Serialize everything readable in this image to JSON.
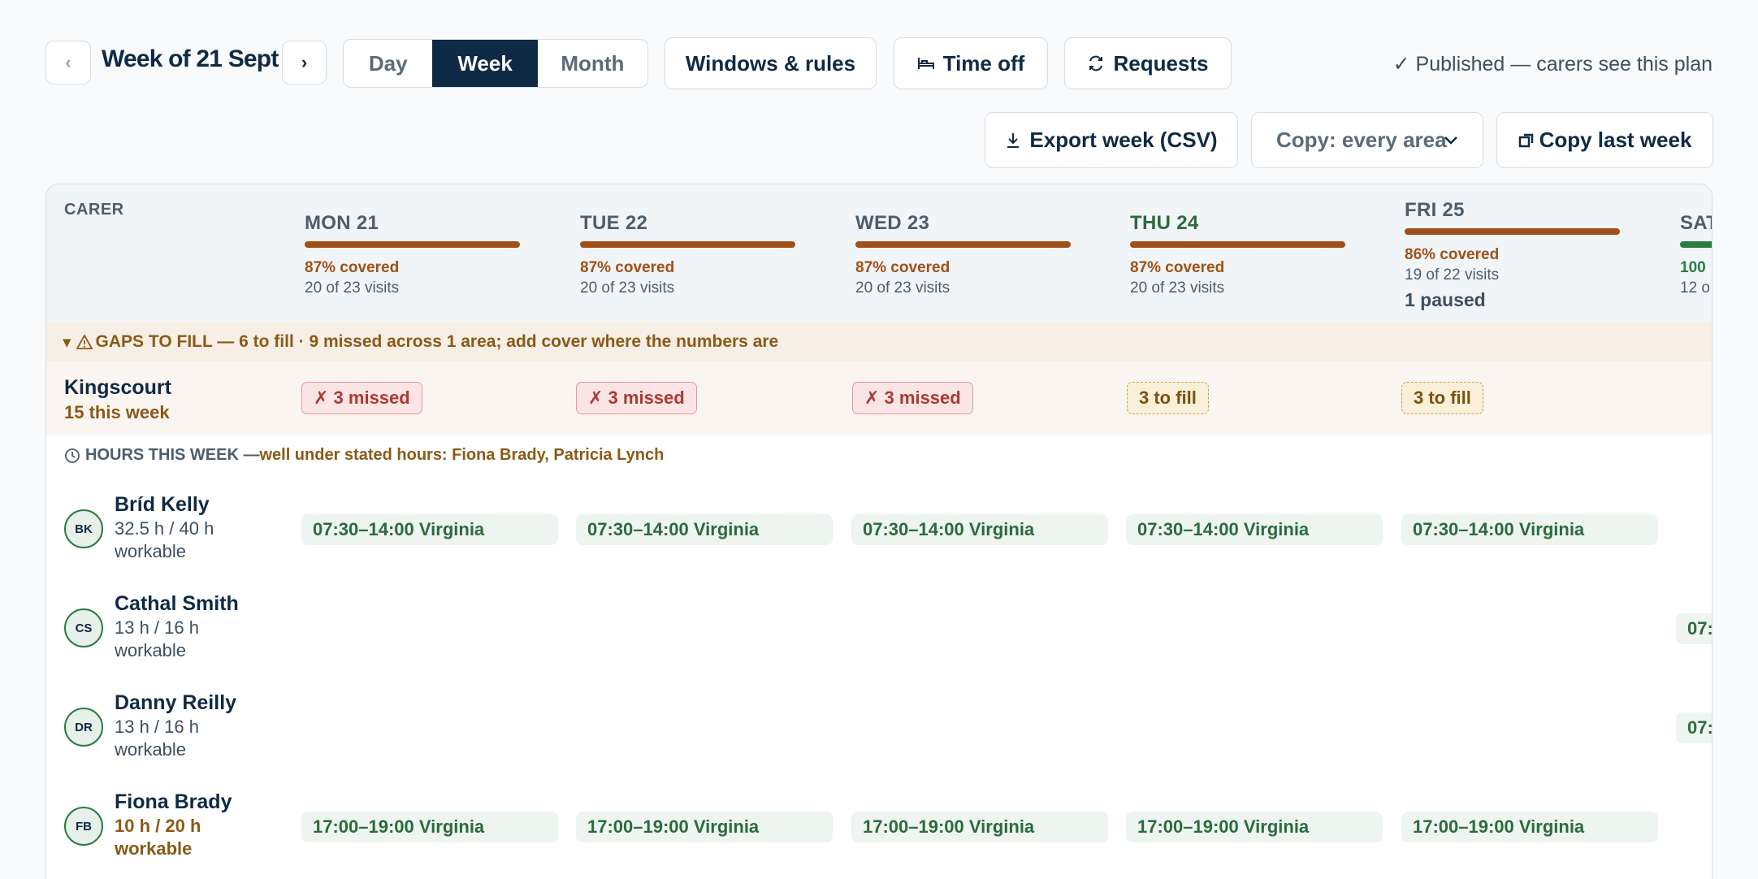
{
  "toolbar": {
    "prev_label": "‹",
    "next_label": "›",
    "week_title": "Week of 21 Sept",
    "views": [
      "Day",
      "Week",
      "Month"
    ],
    "active_view": "Week",
    "windows_label": "Windows & rules",
    "timeoff_label": "Time off",
    "requests_label": "Requests",
    "published_status": "✓ Published — carers see this plan",
    "export_label": "Export week (CSV)",
    "copy_select_value": "Copy: every area",
    "copy_last_label": "Copy last week"
  },
  "grid": {
    "carer_header": "CARER",
    "days": [
      {
        "label": "MON 21",
        "pct": "87% covered",
        "visits": "20 of 23 visits",
        "paused": ""
      },
      {
        "label": "TUE 22",
        "pct": "87% covered",
        "visits": "20 of 23 visits",
        "paused": ""
      },
      {
        "label": "WED 23",
        "pct": "87% covered",
        "visits": "20 of 23 visits",
        "paused": ""
      },
      {
        "label": "THU 24",
        "pct": "87% covered",
        "visits": "20 of 23 visits",
        "paused": ""
      },
      {
        "label": "FRI 25",
        "pct": "86% covered",
        "visits": "19 of 22 visits",
        "paused": "1 paused"
      },
      {
        "label": "SAT",
        "pct": "100",
        "visits": "12 o",
        "paused": ""
      }
    ],
    "gaps_banner": "GAPS TO FILL — 6 to fill · 9 missed across 1 area; add cover where the numbers are",
    "gap_area": {
      "name": "Kingscourt",
      "count": "15 this week",
      "chips": [
        "✗ 3 missed",
        "✗ 3 missed",
        "✗ 3 missed",
        "3 to fill",
        "3 to fill"
      ]
    },
    "hours_banner": {
      "label": "HOURS THIS WEEK — ",
      "detail": "well under stated hours: Fiona Brady, Patricia Lynch"
    },
    "carers": [
      {
        "initials": "BK",
        "name": "Bríd Kelly",
        "hours": "32.5 h / 40 h workable",
        "shifts": [
          "07:30–14:00 Virginia",
          "07:30–14:00 Virginia",
          "07:30–14:00 Virginia",
          "07:30–14:00 Virginia",
          "07:30–14:00 Virginia"
        ],
        "sat_shift": ""
      },
      {
        "initials": "CS",
        "name": "Cathal Smith",
        "hours": "13 h / 16 h workable",
        "shifts": [],
        "sat_shift": "07:"
      },
      {
        "initials": "DR",
        "name": "Danny Reilly",
        "hours": "13 h / 16 h workable",
        "shifts": [],
        "sat_shift": "07:"
      },
      {
        "initials": "FB",
        "name": "Fiona Brady",
        "hours": "10 h / 20 h workable",
        "shifts": [
          "17:00–19:00 Virginia",
          "17:00–19:00 Virginia",
          "17:00–19:00 Virginia",
          "17:00–19:00 Virginia",
          "17:00–19:00 Virginia"
        ],
        "sat_shift": ""
      }
    ]
  }
}
